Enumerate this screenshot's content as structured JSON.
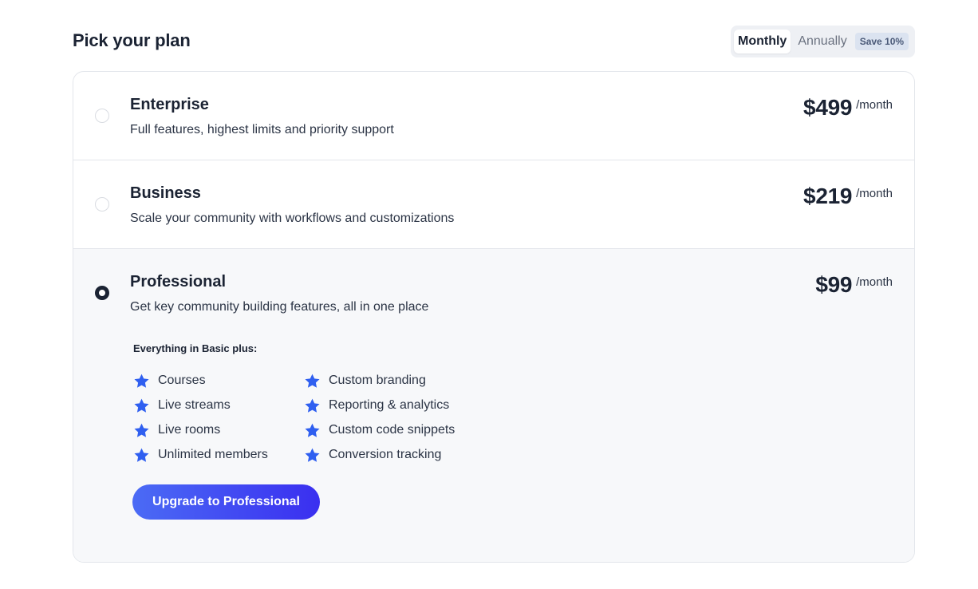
{
  "header": {
    "title": "Pick your plan"
  },
  "billing": {
    "monthly_label": "Monthly",
    "annually_label": "Annually",
    "save_badge": "Save 10%",
    "selected": "Monthly"
  },
  "plans": [
    {
      "name": "Enterprise",
      "description": "Full features, highest limits and priority support",
      "price": "$499",
      "period": "/month",
      "selected": false
    },
    {
      "name": "Business",
      "description": "Scale your community with workflows and customizations",
      "price": "$219",
      "period": "/month",
      "selected": false
    },
    {
      "name": "Professional",
      "description": "Get key community building features, all in one place",
      "price": "$99",
      "period": "/month",
      "selected": true,
      "features_heading": "Everything in Basic plus:",
      "features": [
        "Courses",
        "Custom branding",
        "Live streams",
        "Reporting & analytics",
        "Live rooms",
        "Custom code snippets",
        "Unlimited members",
        "Conversion tracking"
      ],
      "cta": "Upgrade to Professional"
    }
  ],
  "colors": {
    "accent_start": "#4b6bf5",
    "accent_end": "#3a2ff0",
    "star": "#2f5ff0",
    "text": "#1b2333",
    "selected_bg": "#f7f8fa"
  },
  "icons": {
    "feature": "star-icon"
  }
}
